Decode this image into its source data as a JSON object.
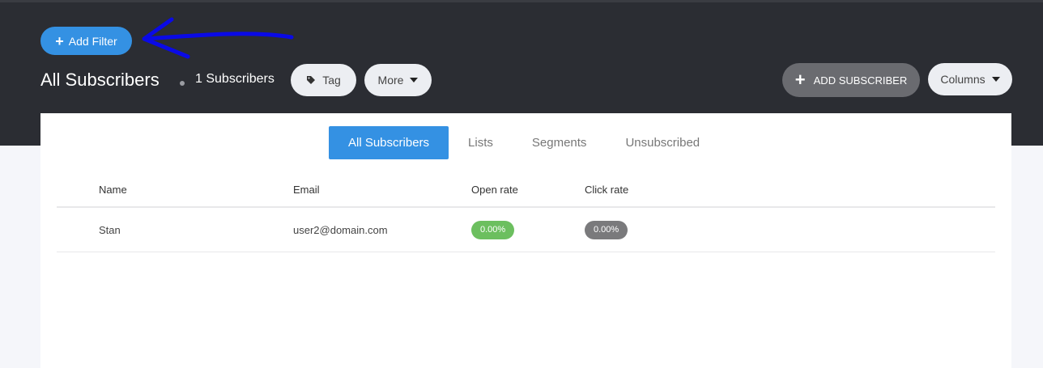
{
  "header": {
    "add_filter_label": "Add Filter",
    "title": "All Subscribers",
    "subscriber_count": "1 Subscribers",
    "tag_label": "Tag",
    "more_label": "More",
    "add_subscriber_label": "ADD SUBSCRIBER",
    "columns_label": "Columns"
  },
  "tabs": [
    {
      "label": "All Subscribers",
      "active": true
    },
    {
      "label": "Lists",
      "active": false
    },
    {
      "label": "Segments",
      "active": false
    },
    {
      "label": "Unsubscribed",
      "active": false
    }
  ],
  "table": {
    "columns": [
      "Name",
      "Email",
      "Open rate",
      "Click rate"
    ],
    "rows": [
      {
        "name": "Stan",
        "email": "user2@domain.com",
        "open_rate": "0.00%",
        "click_rate": "0.00%"
      }
    ]
  },
  "colors": {
    "topbar": "#2b2d33",
    "accent": "#3491e3",
    "open_rate_badge": "#6cbf5f",
    "click_rate_badge": "#7a7a7c",
    "annotation_arrow": "#0a0ae6"
  }
}
